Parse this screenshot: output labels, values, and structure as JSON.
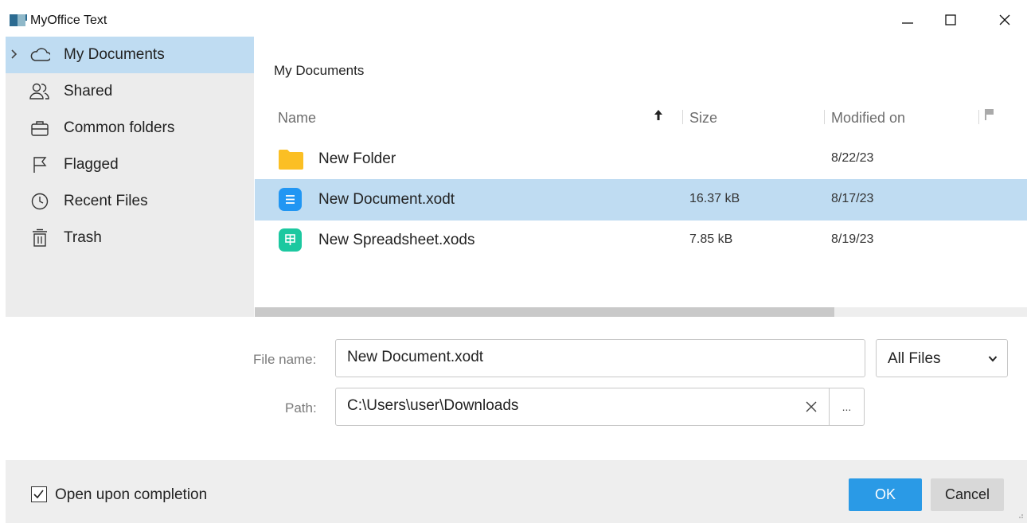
{
  "window": {
    "title": "MyOffice Text",
    "controls": [
      "minimize",
      "maximize",
      "close"
    ]
  },
  "sidebar": {
    "items": [
      {
        "label": "My Documents",
        "icon": "cloud-icon",
        "active": true
      },
      {
        "label": "Shared",
        "icon": "people-icon",
        "active": false
      },
      {
        "label": "Common folders",
        "icon": "briefcase-icon",
        "active": false
      },
      {
        "label": "Flagged",
        "icon": "flag-icon",
        "active": false
      },
      {
        "label": "Recent Files",
        "icon": "clock-icon",
        "active": false
      },
      {
        "label": "Trash",
        "icon": "trash-icon",
        "active": false
      }
    ]
  },
  "main": {
    "breadcrumb": "My Documents",
    "columns": {
      "name": "Name",
      "size": "Size",
      "modified": "Modified on"
    },
    "sort": {
      "column": "Name",
      "direction": "ascending"
    },
    "rows": [
      {
        "name": "New Folder",
        "size": "",
        "modified": "8/22/23",
        "type": "folder",
        "selected": false
      },
      {
        "name": "New Document.xodt",
        "size": "16.37 kB",
        "modified": "8/17/23",
        "type": "text-document",
        "selected": true
      },
      {
        "name": "New Spreadsheet.xods",
        "size": "7.85 kB",
        "modified": "8/19/23",
        "type": "spreadsheet",
        "selected": false
      }
    ],
    "horizontal_scroll_fraction": 0.75
  },
  "form": {
    "file_name_label": "File name:",
    "file_name_value": "New Document.xodt",
    "file_type": "All Files",
    "path_label": "Path:",
    "path_value": "C:\\Users\\user\\Downloads",
    "browse_label": "..."
  },
  "footer": {
    "open_upon_completion_label": "Open upon completion",
    "open_upon_completion_checked": true,
    "ok_label": "OK",
    "cancel_label": "Cancel"
  },
  "colors": {
    "selection": "#bfdcf2",
    "sidebar_bg": "#ececec",
    "ok_button": "#2a9ae6",
    "folder": "#fbbf24",
    "document_icon": "#2196f3",
    "spreadsheet_icon": "#1cc8a0"
  }
}
